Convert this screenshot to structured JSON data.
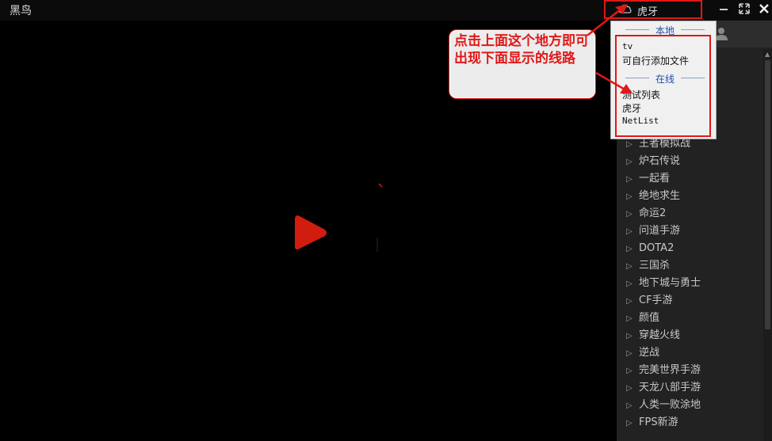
{
  "titlebar": {
    "app_title": "黑鸟",
    "source_label": "虎牙"
  },
  "dropdown": {
    "local_header": "本地",
    "local_items": [
      "tv",
      "可自行添加文件"
    ],
    "online_header": "在线",
    "online_items": [
      "测试列表",
      "虎牙",
      "NetList"
    ]
  },
  "callout": {
    "text": "点击上面这个地方即可出现下面显示的线路"
  },
  "sidebar": {
    "categories": [
      "王者模拟战",
      "炉石传说",
      "一起看",
      "绝地求生",
      "命运2",
      "问道手游",
      "DOTA2",
      "三国杀",
      "地下城与勇士",
      "CF手游",
      "颜值",
      "穿越火线",
      "逆战",
      "完美世界手游",
      "天龙八部手游",
      "人类一败涂地",
      "FPS新游"
    ]
  },
  "colors": {
    "highlight": "#e01818",
    "accent": "#1f4fa8"
  }
}
